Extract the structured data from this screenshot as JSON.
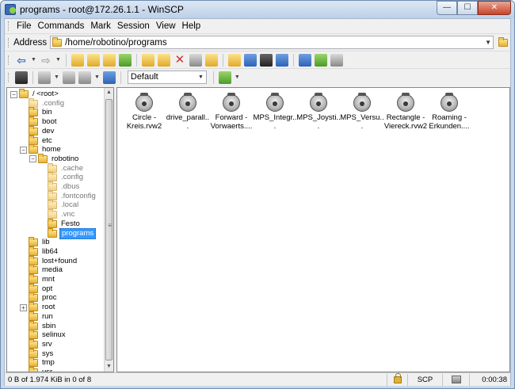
{
  "window": {
    "title": "programs - root@172.26.1.1 - WinSCP",
    "controls": {
      "minimize": "—",
      "maximize": "☐",
      "close": "✕"
    }
  },
  "menu": [
    "File",
    "Commands",
    "Mark",
    "Session",
    "View",
    "Help"
  ],
  "address": {
    "label": "Address",
    "path": "/home/robotino/programs"
  },
  "toolbar2": {
    "session_preset": "Default"
  },
  "tree": {
    "nodes": [
      {
        "label": "/ <root>",
        "depth": 0,
        "expander": "−",
        "hidden": false
      },
      {
        "label": ".config",
        "depth": 1,
        "expander": "",
        "hidden": true
      },
      {
        "label": "bin",
        "depth": 1,
        "expander": "",
        "hidden": false
      },
      {
        "label": "boot",
        "depth": 1,
        "expander": "",
        "hidden": false
      },
      {
        "label": "dev",
        "depth": 1,
        "expander": "",
        "hidden": false
      },
      {
        "label": "etc",
        "depth": 1,
        "expander": "",
        "hidden": false
      },
      {
        "label": "home",
        "depth": 1,
        "expander": "−",
        "hidden": false
      },
      {
        "label": "robotino",
        "depth": 2,
        "expander": "−",
        "hidden": false
      },
      {
        "label": ".cache",
        "depth": 3,
        "expander": "",
        "hidden": true
      },
      {
        "label": ".config",
        "depth": 3,
        "expander": "",
        "hidden": true
      },
      {
        "label": ".dbus",
        "depth": 3,
        "expander": "",
        "hidden": true
      },
      {
        "label": ".fontconfig",
        "depth": 3,
        "expander": "",
        "hidden": true
      },
      {
        "label": ".local",
        "depth": 3,
        "expander": "",
        "hidden": true
      },
      {
        "label": ".vnc",
        "depth": 3,
        "expander": "",
        "hidden": true
      },
      {
        "label": "Festo",
        "depth": 3,
        "expander": "",
        "hidden": false
      },
      {
        "label": "programs",
        "depth": 3,
        "expander": "",
        "hidden": false,
        "selected": true
      },
      {
        "label": "lib",
        "depth": 1,
        "expander": "",
        "hidden": false
      },
      {
        "label": "lib64",
        "depth": 1,
        "expander": "",
        "hidden": false
      },
      {
        "label": "lost+found",
        "depth": 1,
        "expander": "",
        "hidden": false
      },
      {
        "label": "media",
        "depth": 1,
        "expander": "",
        "hidden": false
      },
      {
        "label": "mnt",
        "depth": 1,
        "expander": "",
        "hidden": false
      },
      {
        "label": "opt",
        "depth": 1,
        "expander": "",
        "hidden": false
      },
      {
        "label": "proc",
        "depth": 1,
        "expander": "",
        "hidden": false
      },
      {
        "label": "root",
        "depth": 1,
        "expander": "+",
        "hidden": false
      },
      {
        "label": "run",
        "depth": 1,
        "expander": "",
        "hidden": false
      },
      {
        "label": "sbin",
        "depth": 1,
        "expander": "",
        "hidden": false
      },
      {
        "label": "selinux",
        "depth": 1,
        "expander": "",
        "hidden": false
      },
      {
        "label": "srv",
        "depth": 1,
        "expander": "",
        "hidden": false
      },
      {
        "label": "sys",
        "depth": 1,
        "expander": "",
        "hidden": false
      },
      {
        "label": "tmp",
        "depth": 1,
        "expander": "",
        "hidden": false
      },
      {
        "label": "usr",
        "depth": 1,
        "expander": "",
        "hidden": false
      }
    ]
  },
  "files": [
    {
      "name": "Circle - Kreis.rvw2"
    },
    {
      "name": "drive_parall..."
    },
    {
      "name": "Forward - Vorwaerts...."
    },
    {
      "name": "MPS_Integr..."
    },
    {
      "name": "MPS_Joysti..."
    },
    {
      "name": "MPS_Versu..."
    },
    {
      "name": "Rectangle - Viereck.rvw2"
    },
    {
      "name": "Roaming - Erkunden...."
    }
  ],
  "status": {
    "selection": "0 B of 1.974 KiB in 0 of 8",
    "protocol": "SCP",
    "elapsed": "0:00:38"
  }
}
